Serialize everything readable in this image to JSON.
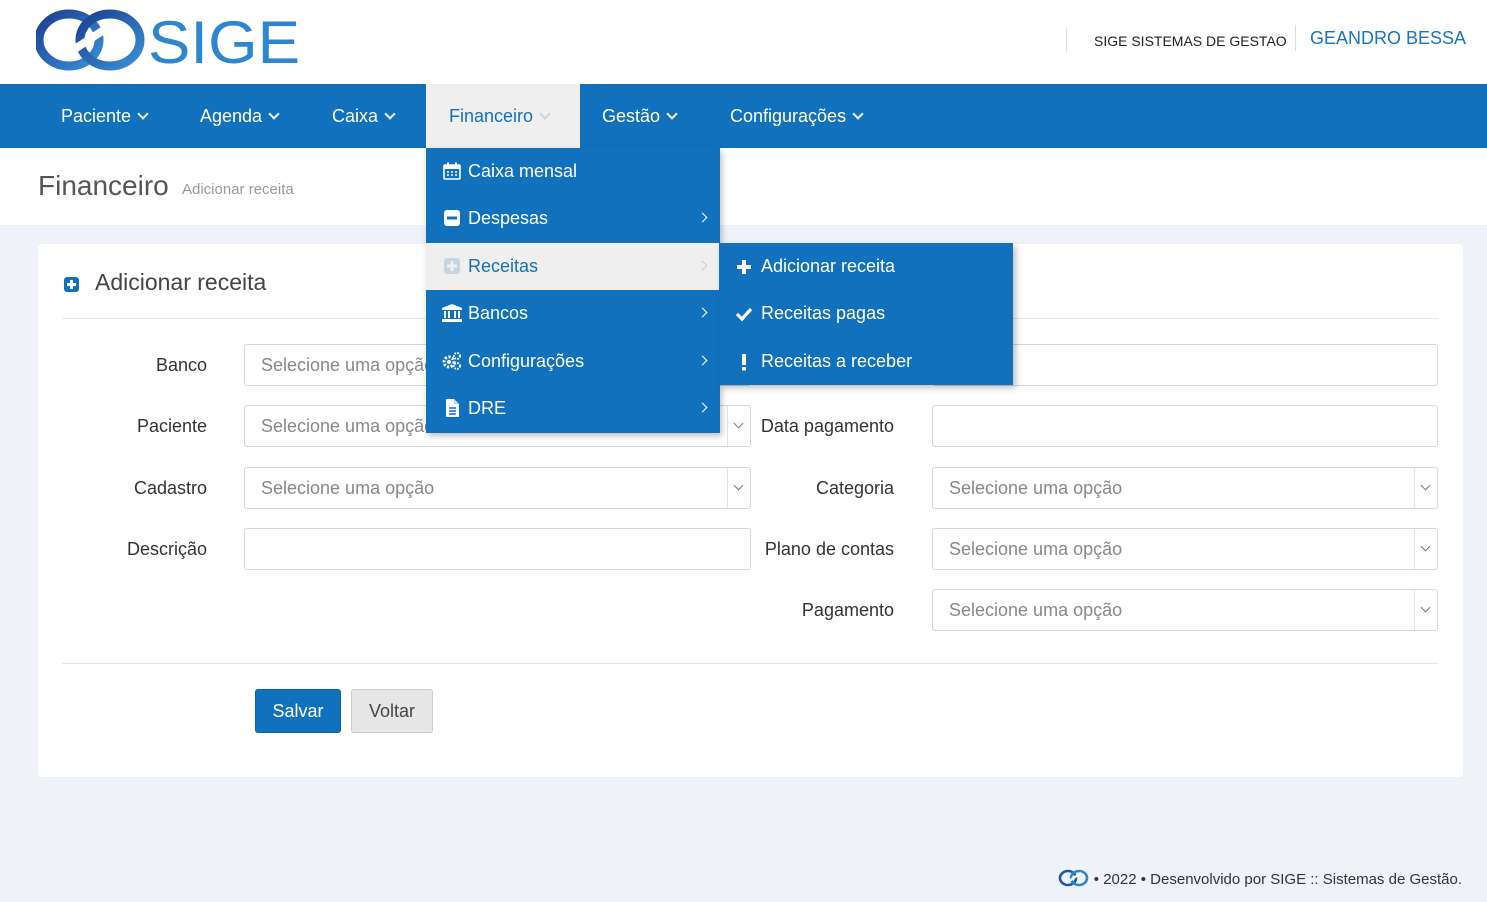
{
  "header": {
    "logo_text": "SIGE",
    "company": "SIGE SISTEMAS DE GESTAO",
    "user": "GEANDRO BESSA"
  },
  "nav": {
    "items": [
      {
        "label": "Paciente"
      },
      {
        "label": "Agenda"
      },
      {
        "label": "Caixa"
      },
      {
        "label": "Financeiro",
        "active": true
      },
      {
        "label": "Gestão"
      },
      {
        "label": "Configurações"
      }
    ]
  },
  "page": {
    "title": "Financeiro",
    "subtitle": "Adicionar receita"
  },
  "card": {
    "title": "Adicionar receita",
    "icon": "plus-square-icon"
  },
  "form": {
    "banco": {
      "label": "Banco",
      "placeholder": "Selecione uma opção"
    },
    "paciente": {
      "label": "Paciente",
      "placeholder": "Selecione uma opção"
    },
    "cadastro": {
      "label": "Cadastro",
      "placeholder": "Selecione uma opção"
    },
    "descricao": {
      "label": "Descrição",
      "value": ""
    },
    "valor": {
      "value": ""
    },
    "data_pagamento": {
      "label": "Data pagamento",
      "value": ""
    },
    "categoria": {
      "label": "Categoria",
      "placeholder": "Selecione uma opção"
    },
    "plano_contas": {
      "label": "Plano de contas",
      "placeholder": "Selecione uma opção"
    },
    "pagamento": {
      "label": "Pagamento",
      "placeholder": "Selecione uma opção"
    }
  },
  "buttons": {
    "save": "Salvar",
    "back": "Voltar"
  },
  "dropdown": {
    "items": [
      {
        "label": "Caixa mensal",
        "icon": "calendar-icon"
      },
      {
        "label": "Despesas",
        "icon": "minus-square-icon"
      },
      {
        "label": "Receitas",
        "icon": "plus-square-icon",
        "active": true
      },
      {
        "label": "Bancos",
        "icon": "bank-icon"
      },
      {
        "label": "Configurações",
        "icon": "cogs-icon"
      },
      {
        "label": "DRE",
        "icon": "file-icon"
      }
    ]
  },
  "submenu": {
    "items": [
      {
        "label": "Adicionar receita",
        "icon": "plus-icon"
      },
      {
        "label": "Receitas pagas",
        "icon": "check-icon"
      },
      {
        "label": "Receitas a receber",
        "icon": "exclamation-icon"
      }
    ]
  },
  "footer": {
    "text": "• 2022 • Desenvolvido por SIGE :: Sistemas de Gestão."
  },
  "colors": {
    "primary": "#1271bd",
    "background": "#eff3f8"
  }
}
